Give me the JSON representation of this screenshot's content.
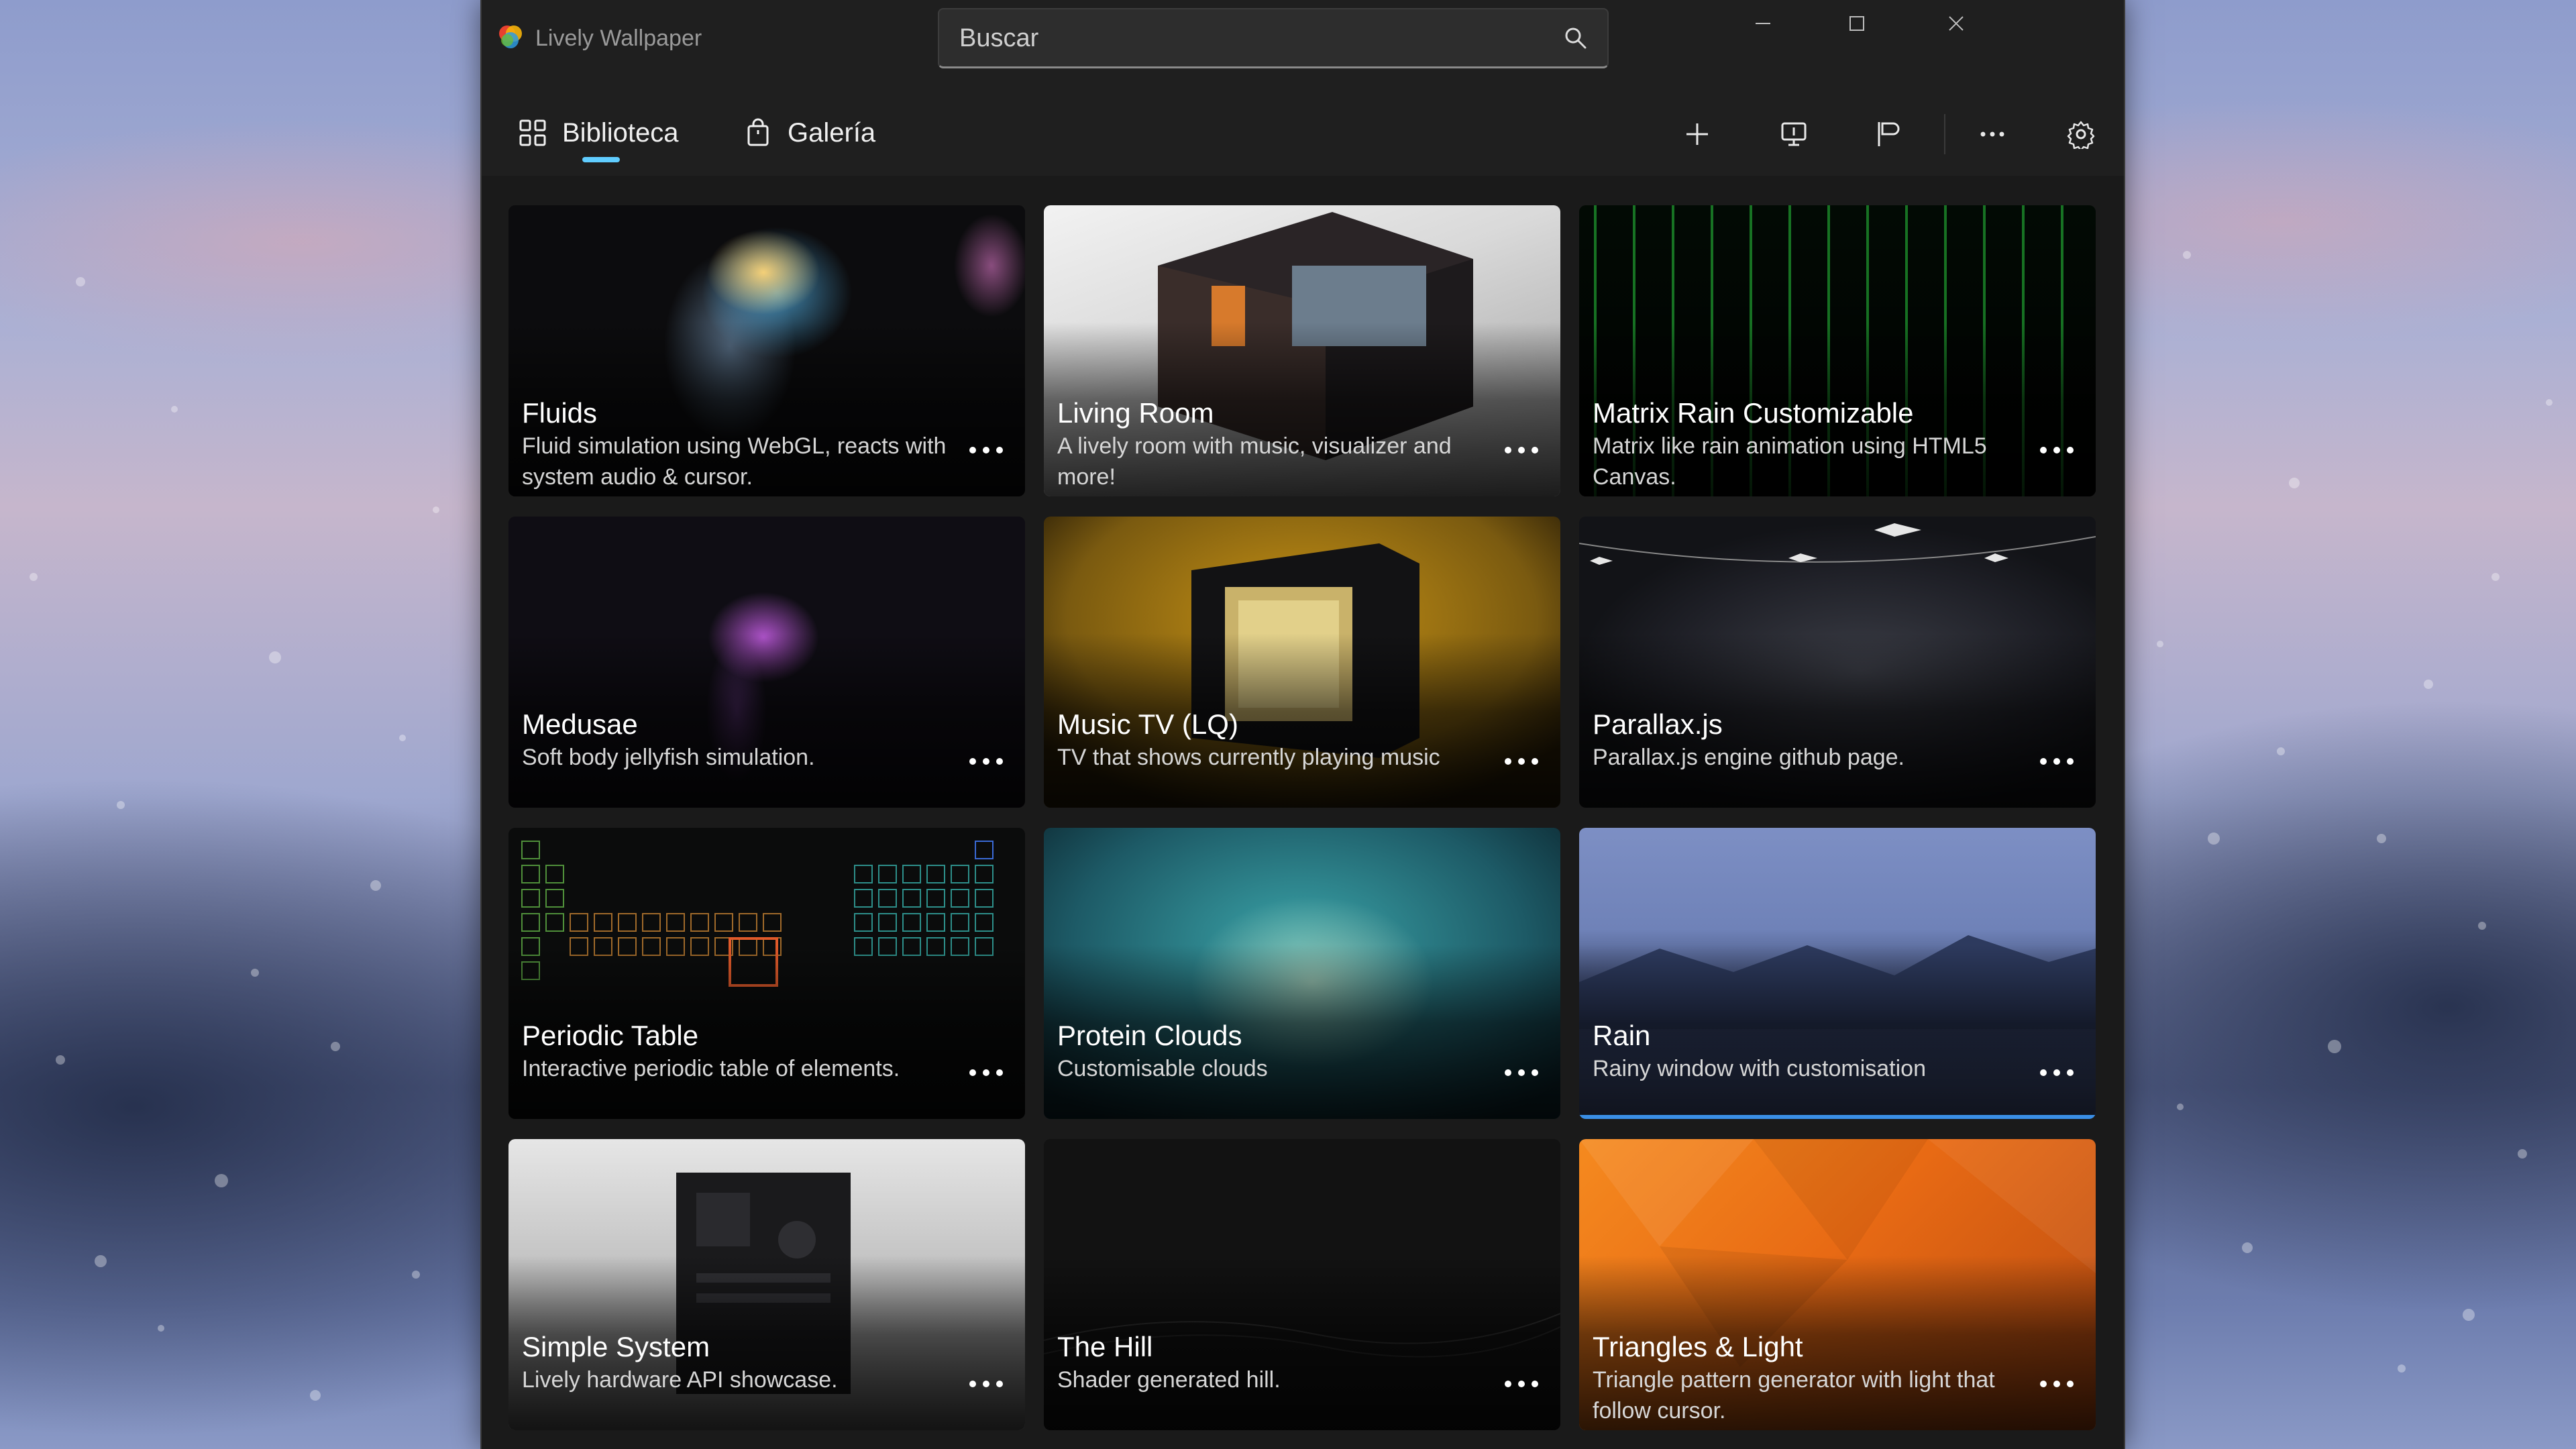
{
  "app": {
    "title": "Lively Wallpaper"
  },
  "search": {
    "value": "",
    "placeholder": "Buscar"
  },
  "nav": {
    "tabs": [
      {
        "label": "Biblioteca",
        "selected": true
      },
      {
        "label": "Galería",
        "selected": false
      }
    ]
  },
  "colors": {
    "accent": "#60cdff",
    "selection": "#3a8ee6",
    "window": "#1f1f1f",
    "content": "#1a1a1a"
  },
  "library": {
    "items": [
      {
        "title": "Fluids",
        "description": "Fluid simulation using WebGL, reacts with system audio & cursor.",
        "selected": false
      },
      {
        "title": "Living Room",
        "description": "A lively room with music, visualizer and more!",
        "selected": false
      },
      {
        "title": "Matrix Rain Customizable",
        "description": "Matrix like rain animation using HTML5 Canvas.",
        "selected": false
      },
      {
        "title": "Medusae",
        "description": "Soft body jellyfish simulation.",
        "selected": false
      },
      {
        "title": "Music TV (LQ)",
        "description": "TV that shows currently playing music",
        "selected": false
      },
      {
        "title": "Parallax.js",
        "description": "Parallax.js engine github page.",
        "selected": false
      },
      {
        "title": "Periodic Table",
        "description": "Interactive periodic table of elements.",
        "selected": false
      },
      {
        "title": "Protein Clouds",
        "description": "Customisable clouds",
        "selected": false
      },
      {
        "title": "Rain",
        "description": "Rainy window with customisation",
        "selected": true
      },
      {
        "title": "Simple System",
        "description": "Lively hardware API showcase.",
        "selected": false
      },
      {
        "title": "The Hill",
        "description": "Shader generated hill.",
        "selected": false
      },
      {
        "title": "Triangles & Light",
        "description": "Triangle pattern generator with light that follow cursor.",
        "selected": false
      }
    ]
  }
}
